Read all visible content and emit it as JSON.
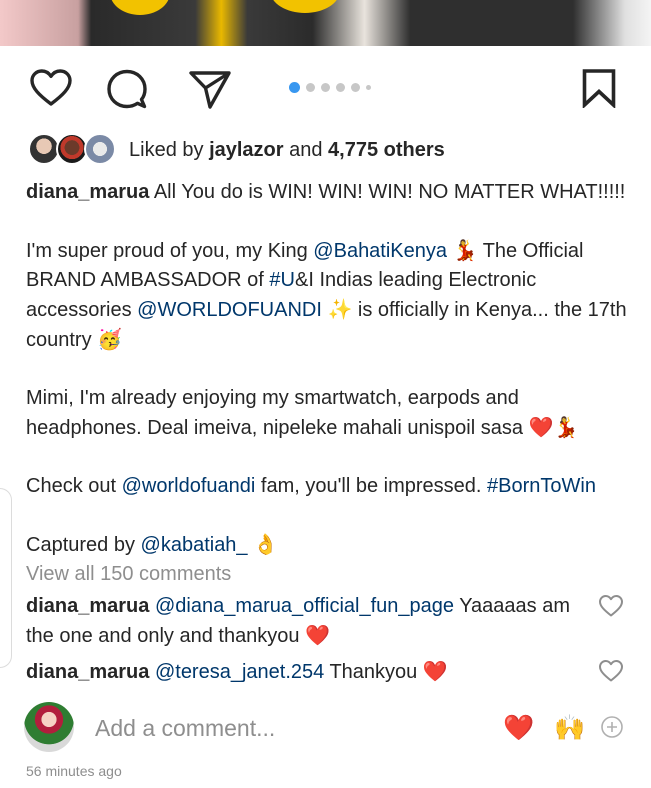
{
  "post": {
    "like_prefix": "Liked by",
    "liked_by_user": "jaylazor",
    "like_and": "and",
    "other_count": "4,775 others",
    "caption": {
      "username": "diana_marua",
      "line1": "All You do is WIN! WIN! WIN! NO MATTER WHAT!!!!!",
      "p2_text1": "I'm super proud of you, my King ",
      "p2_mention1": "@BahatiKenya",
      "p2_emoji1": "💃",
      "p2_text2": " The Official BRAND AMBASSADOR of ",
      "p2_tag1": "#U",
      "p2_text3": "&I Indias leading Electronic accessories ",
      "p2_mention2": "@WORLDOFUANDI",
      "p2_emoji2": "✨",
      "p2_text4": " is officially in Kenya... the 17th country ",
      "p2_emoji3": "🥳",
      "p3_text": "Mimi, I'm already enjoying my smartwatch, earpods and headphones. Deal imeiva, nipeleke mahali unispoil sasa ",
      "p3_emoji1": "❤️",
      "p3_emoji2": "💃",
      "p4_text1": "Check out ",
      "p4_mention": "@worldofuandi",
      "p4_text2": " fam, you'll be impressed. ",
      "p4_tag": "#BornToWin",
      "p5_text": "Captured by ",
      "p5_mention": "@kabatiah_",
      "p5_emoji": "👌"
    },
    "view_all_comments": "View all 150 comments",
    "comments": [
      {
        "username": "diana_marua",
        "mention": "@diana_marua_official_fun_page",
        "text": " Yaaaaas am the one and only and thankyou ",
        "emoji": "❤️"
      },
      {
        "username": "diana_marua",
        "mention": "@teresa_janet.254",
        "text": " Thankyou ",
        "emoji": "❤️"
      }
    ],
    "add_comment_placeholder": "Add a comment...",
    "quick_reactions": [
      "❤️",
      "🙌"
    ],
    "timestamp": "56 minutes ago",
    "carousel": {
      "total_slides": 6,
      "active_index": 0
    }
  },
  "colors": {
    "text": "#262626",
    "secondary_text": "#8e8e8e",
    "link": "#00376b",
    "carousel_active": "#3897f0"
  },
  "icons": [
    "heart-icon",
    "comment-icon",
    "share-icon",
    "bookmark-icon",
    "heart-outline-icon",
    "plus-circle-icon"
  ]
}
